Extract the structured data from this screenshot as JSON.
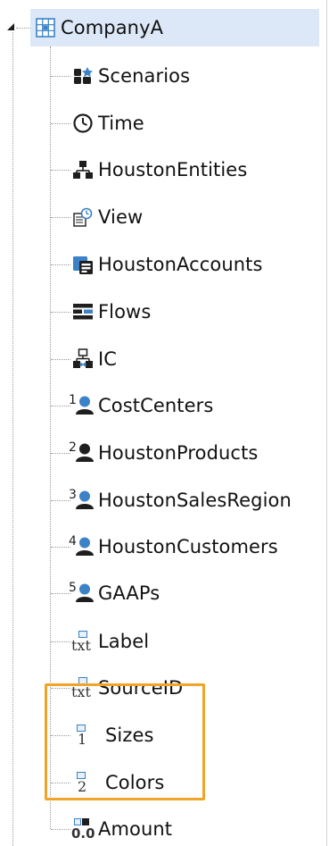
{
  "tree": {
    "root": {
      "label": "CompanyA",
      "icon": "cube-grid-icon",
      "expanded": true,
      "selected": true
    },
    "children": [
      {
        "label": "Scenarios",
        "icon": "scenarios-icon"
      },
      {
        "label": "Time",
        "icon": "clock-icon"
      },
      {
        "label": "HoustonEntities",
        "icon": "hierarchy-icon"
      },
      {
        "label": "View",
        "icon": "view-icon"
      },
      {
        "label": "HoustonAccounts",
        "icon": "accounts-icon"
      },
      {
        "label": "Flows",
        "icon": "flows-icon"
      },
      {
        "label": "IC",
        "icon": "intercompany-icon"
      },
      {
        "label": "CostCenters",
        "icon": "user-defined-1-icon",
        "badge": "1"
      },
      {
        "label": "HoustonProducts",
        "icon": "user-defined-2-icon",
        "badge": "2"
      },
      {
        "label": "HoustonSalesRegion",
        "icon": "user-defined-3-icon",
        "badge": "3"
      },
      {
        "label": "HoustonCustomers",
        "icon": "user-defined-4-icon",
        "badge": "4"
      },
      {
        "label": "GAAPs",
        "icon": "user-defined-5-icon",
        "badge": "5"
      },
      {
        "label": "Label",
        "icon": "text-property-icon",
        "glyph": "txt"
      },
      {
        "label": "SourceID",
        "icon": "text-property-icon",
        "glyph": "txt"
      },
      {
        "label": "Sizes",
        "icon": "numbered-property-icon",
        "glyph": "1",
        "highlighted": true
      },
      {
        "label": "Colors",
        "icon": "numbered-property-icon",
        "glyph": "2",
        "highlighted": true
      },
      {
        "label": "Amount",
        "icon": "decimal-property-icon",
        "glyph": "0.0"
      }
    ]
  },
  "colors": {
    "selection": "#dce8f7",
    "highlight_border": "#f0a428",
    "icon_blue": "#3b82c6",
    "icon_dark": "#1e1e1e",
    "connector": "#9a9a9a"
  }
}
